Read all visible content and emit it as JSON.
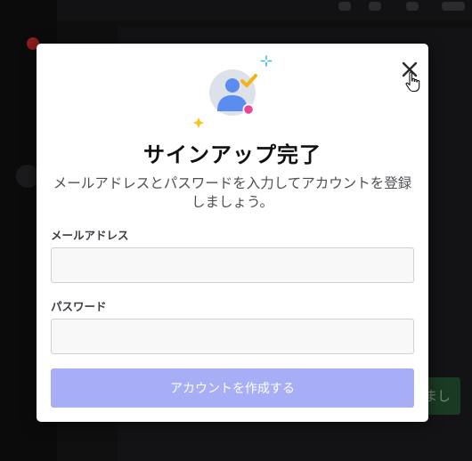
{
  "background": {
    "green_button_label": "まし"
  },
  "modal": {
    "title": "サインアップ完了",
    "subtitle": "メールアドレスとパスワードを入力してアカウントを登録しましょう。",
    "email_label": "メールアドレス",
    "email_value": "",
    "password_label": "パスワード",
    "password_value": "",
    "submit_label": "アカウントを作成する"
  },
  "colors": {
    "submit_button": "#a8aef5",
    "illustration_avatar": "#5b8cf0",
    "check": "#f5b316",
    "status_dot": "#e9479b",
    "sparkle_blue": "#36b8e6",
    "sparkle_yellow": "#f5c518"
  },
  "icons": {
    "close": "close-icon",
    "avatar": "user-avatar-icon",
    "check": "check-icon",
    "sparkle": "sparkle-icon",
    "cursor": "hand-pointer-icon"
  }
}
